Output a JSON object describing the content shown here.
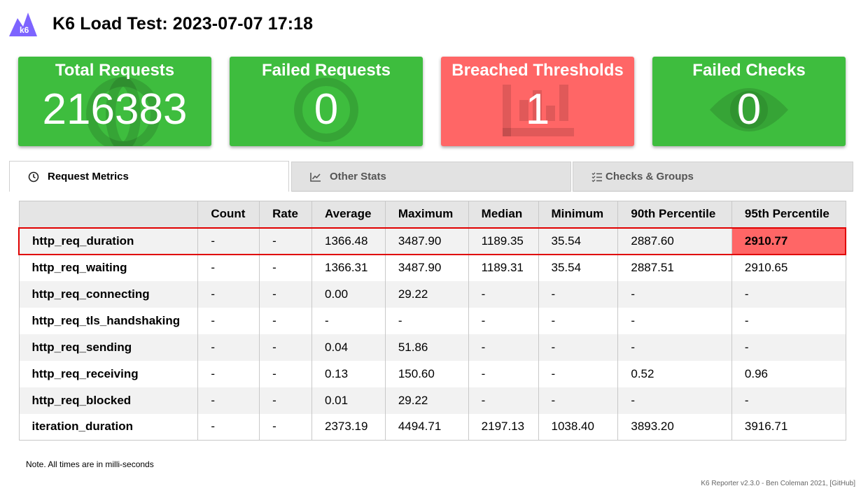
{
  "header": {
    "logo_text": "k6",
    "title": "K6 Load Test: 2023-07-07 17:18"
  },
  "cards": [
    {
      "title": "Total Requests",
      "value": "216383",
      "status": "green",
      "icon": "globe-icon"
    },
    {
      "title": "Failed Requests",
      "value": "0",
      "status": "green",
      "icon": "circle-icon"
    },
    {
      "title": "Breached Thresholds",
      "value": "1",
      "status": "red",
      "icon": "bar-chart-icon"
    },
    {
      "title": "Failed Checks",
      "value": "0",
      "status": "green",
      "icon": "eye-icon"
    }
  ],
  "tabs": [
    {
      "label": "Request Metrics",
      "icon": "clock-icon",
      "active": true
    },
    {
      "label": "Other Stats",
      "icon": "line-chart-icon",
      "active": false
    },
    {
      "label": "Checks & Groups",
      "icon": "checklist-icon",
      "active": false
    }
  ],
  "table": {
    "headers": [
      "",
      "Count",
      "Rate",
      "Average",
      "Maximum",
      "Median",
      "Minimum",
      "90th Percentile",
      "95th Percentile"
    ],
    "rows": [
      [
        "http_req_duration",
        "-",
        "-",
        "1366.48",
        "3487.90",
        "1189.35",
        "35.54",
        "2887.60",
        "2910.77"
      ],
      [
        "http_req_waiting",
        "-",
        "-",
        "1366.31",
        "3487.90",
        "1189.31",
        "35.54",
        "2887.51",
        "2910.65"
      ],
      [
        "http_req_connecting",
        "-",
        "-",
        "0.00",
        "29.22",
        "-",
        "-",
        "-",
        "-"
      ],
      [
        "http_req_tls_handshaking",
        "-",
        "-",
        "-",
        "-",
        "-",
        "-",
        "-",
        "-"
      ],
      [
        "http_req_sending",
        "-",
        "-",
        "0.04",
        "51.86",
        "-",
        "-",
        "-",
        "-"
      ],
      [
        "http_req_receiving",
        "-",
        "-",
        "0.13",
        "150.60",
        "-",
        "-",
        "0.52",
        "0.96"
      ],
      [
        "http_req_blocked",
        "-",
        "-",
        "0.01",
        "29.22",
        "-",
        "-",
        "-",
        "-"
      ],
      [
        "iteration_duration",
        "-",
        "-",
        "2373.19",
        "4494.71",
        "2197.13",
        "1038.40",
        "3893.20",
        "3916.71"
      ]
    ]
  },
  "note": "Note. All times are in milli-seconds",
  "footer": {
    "text": "K6 Reporter v2.3.0 - Ben Coleman 2021, ",
    "link": "[GitHub]"
  },
  "colors": {
    "pass": "#3ebd3e",
    "fail": "#ff6666",
    "highlight_border": "#e00000",
    "logo": "#7d64ff"
  }
}
